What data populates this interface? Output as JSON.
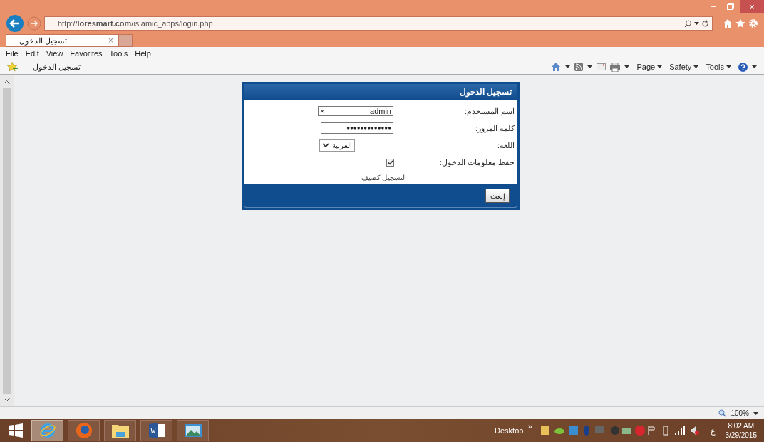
{
  "window": {
    "minimize": "–",
    "close": "×"
  },
  "address_bar": {
    "url": "http://**loresmart.com**/islamic_apps/login.php"
  },
  "tabs": [
    {
      "label": "تسجيل الدخول",
      "close": "×",
      "selected": true
    }
  ],
  "menu_bar": {
    "file": "File",
    "edit": "Edit",
    "view": "View",
    "favorites": "Favorites",
    "tools": "Tools",
    "help": "Help"
  },
  "favorites_bar": {
    "item": "تسجيل الدخول"
  },
  "command_bar": {
    "page": "Page",
    "safety": "Safety",
    "tools": "Tools"
  },
  "login": {
    "title": "تسجيل الدخول",
    "fields": [
      {
        "kind": "text",
        "label": "اسم المستخدم:",
        "value": "admin",
        "clear": "×"
      },
      {
        "kind": "password",
        "label": "كلمة المرور:",
        "value": "●●●●●●●●●●●●●"
      },
      {
        "kind": "select",
        "label": "اللغة:",
        "value": "العربية"
      },
      {
        "kind": "checkbox",
        "label": "حفظ معلومات الدخول:",
        "checked": true
      }
    ],
    "guest_link": "التسجيل كضيف",
    "submit": "إبعث"
  },
  "status_bar": {
    "zoom": "100%"
  },
  "taskbar": {
    "apps": [
      {
        "kind": "ie",
        "selected": true
      },
      {
        "kind": "firefox",
        "selected": false
      },
      {
        "kind": "explorer",
        "selected": false
      },
      {
        "kind": "word",
        "selected": false
      },
      {
        "kind": "photos",
        "selected": false
      }
    ],
    "desktop": "Desktop",
    "overflow": "»",
    "language": "ع",
    "time": "8:02 AM",
    "date": "3/29/2015"
  }
}
